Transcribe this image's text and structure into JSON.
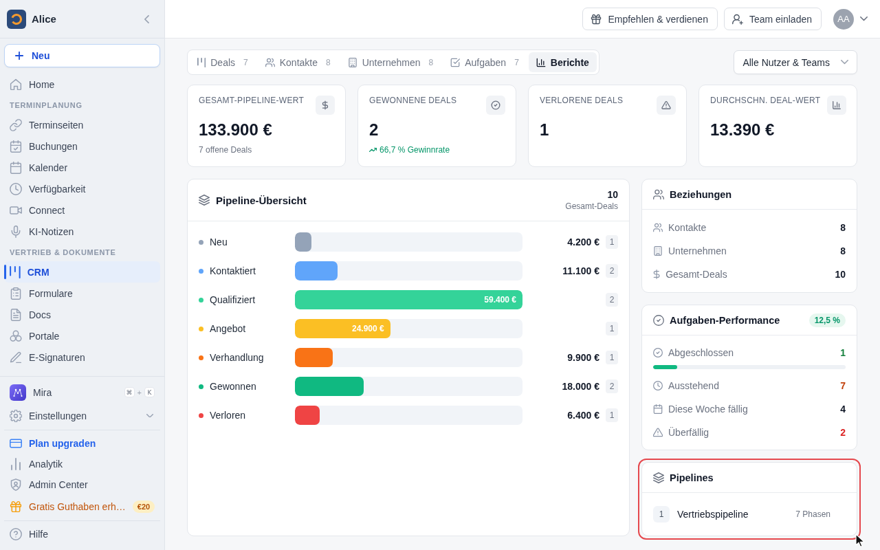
{
  "sidebar": {
    "workspace": "Alice",
    "new_button": "Neu",
    "sections": [
      {
        "items": [
          {
            "label": "Home",
            "selected": false
          }
        ]
      },
      {
        "heading": "TERMINPLANUNG",
        "items": [
          {
            "label": "Terminseiten",
            "selected": false
          },
          {
            "label": "Buchungen",
            "selected": false
          },
          {
            "label": "Kalender",
            "selected": false
          },
          {
            "label": "Verfügbarkeit",
            "selected": false
          },
          {
            "label": "Connect",
            "selected": false
          },
          {
            "label": "KI-Notizen",
            "selected": false
          }
        ]
      },
      {
        "heading": "VERTRIEB & DOKUMENTE",
        "items": [
          {
            "label": "CRM",
            "selected": true
          },
          {
            "label": "Formulare",
            "selected": false
          },
          {
            "label": "Docs",
            "selected": false
          },
          {
            "label": "Portale",
            "selected": false
          },
          {
            "label": "E-Signaturen",
            "selected": false
          }
        ]
      }
    ],
    "assistant": {
      "label": "Mira",
      "shortcut": {
        "keys": [
          "⌘",
          "K"
        ],
        "joiner": "+"
      }
    },
    "settings": {
      "label": "Einstellungen",
      "expanded": false
    },
    "links": [
      {
        "label": "Plan upgraden",
        "kind": "upgrade"
      },
      {
        "label": "Analytik",
        "kind": "plain"
      },
      {
        "label": "Admin Center",
        "kind": "plain"
      },
      {
        "label": "Gratis Guthaben erh…",
        "kind": "promo",
        "badge": "€20"
      }
    ],
    "help": "Hilfe"
  },
  "top_bar": {
    "buttons": [
      {
        "label": "Empfehlen & verdienen"
      },
      {
        "label": "Team einladen"
      }
    ],
    "avatar": "AA"
  },
  "tabs": [
    {
      "label": "Deals",
      "count": "7",
      "selected": false
    },
    {
      "label": "Kontakte",
      "count": "8",
      "selected": false
    },
    {
      "label": "Unternehmen",
      "count": "8",
      "selected": false
    },
    {
      "label": "Aufgaben",
      "count": "7",
      "selected": false
    },
    {
      "label": "Berichte",
      "selected": true
    }
  ],
  "filter": {
    "value": "Alle Nutzer & Teams"
  },
  "stats": [
    {
      "label": "GESAMT-PIPELINE-WERT",
      "value": "133.900 €",
      "note": "7 offene Deals"
    },
    {
      "label": "GEWONNENE DEALS",
      "value": "2",
      "trend": "66,7 % Gewinnrate"
    },
    {
      "label": "VERLORENE DEALS",
      "value": "1"
    },
    {
      "label": "DURCHSCHN. DEAL-WERT",
      "value": "13.390 €"
    }
  ],
  "pipeline_overview": {
    "title": "Pipeline-Übersicht",
    "total": "10",
    "total_label": "Gesamt-Deals",
    "stages": [
      {
        "label": "Neu",
        "color": "#94a3b8",
        "level": 0.071,
        "value": "4.200 €",
        "count": "1"
      },
      {
        "label": "Kontaktiert",
        "color": "#60a5fa",
        "level": 0.187,
        "value": "11.100 €",
        "count": "2"
      },
      {
        "label": "Qualifiziert",
        "color": "#34d399",
        "level": 1,
        "value": "59.400 €",
        "count": "2"
      },
      {
        "label": "Angebot",
        "color": "#fbbf24",
        "level": 0.419,
        "value": "24.900 €",
        "count": "1"
      },
      {
        "label": "Verhandlung",
        "color": "#f97316",
        "level": 0.167,
        "value": "9.900 €",
        "count": "1"
      },
      {
        "label": "Gewonnen",
        "color": "#10b981",
        "level": 0.303,
        "value": "18.000 €",
        "count": "2"
      },
      {
        "label": "Verloren",
        "color": "#ef4444",
        "level": 0.108,
        "value": "6.400 €",
        "count": "1"
      }
    ]
  },
  "relations": {
    "title": "Beziehungen",
    "rows": [
      {
        "label": "Kontakte",
        "value": "8"
      },
      {
        "label": "Unternehmen",
        "value": "8"
      },
      {
        "label": "Gesamt-Deals",
        "value": "10"
      }
    ]
  },
  "tasks": {
    "title": "Aufgaben-Performance",
    "rate": "12,5 %",
    "rows": [
      {
        "kind": "progress",
        "label": "Abgeschlossen",
        "value": "1",
        "color": "#15803d",
        "level": 0.125
      },
      {
        "kind": "count",
        "label": "Ausstehend",
        "value": "7",
        "color": "#c2410c"
      },
      {
        "kind": "count",
        "label": "Diese Woche fällig",
        "value": "4",
        "color": "#111827"
      },
      {
        "kind": "count",
        "label": "Überfällig",
        "value": "2",
        "color": "#dc2626"
      }
    ]
  },
  "pipelines": {
    "title": "Pipelines",
    "highlighted": true,
    "items": [
      {
        "number": "1",
        "name": "Vertriebspipeline",
        "phases": "7 Phasen"
      }
    ]
  }
}
